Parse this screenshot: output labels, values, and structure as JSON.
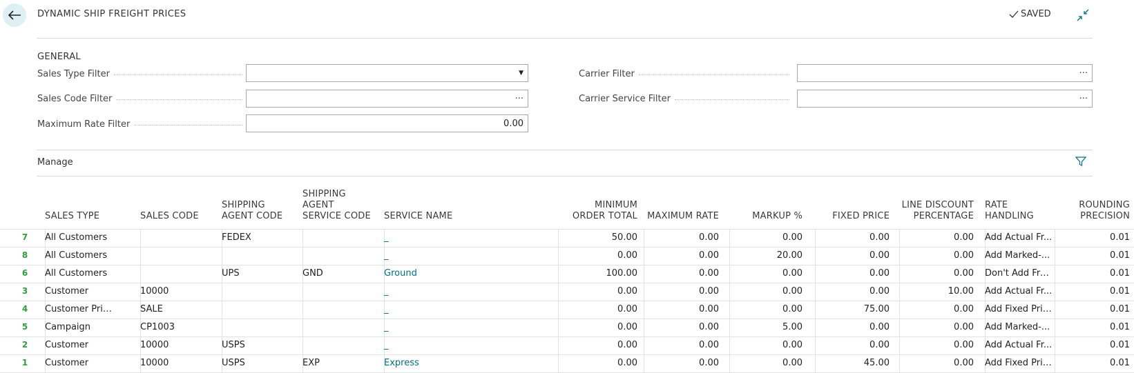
{
  "header": {
    "title": "DYNAMIC SHIP FREIGHT PRICES",
    "saved_label": "SAVED"
  },
  "general": {
    "section_title": "GENERAL",
    "fields": {
      "sales_type_filter": {
        "label": "Sales Type Filter",
        "value": ""
      },
      "sales_code_filter": {
        "label": "Sales Code Filter",
        "value": ""
      },
      "maximum_rate_filter": {
        "label": "Maximum Rate Filter",
        "value": "0.00"
      },
      "carrier_filter": {
        "label": "Carrier Filter",
        "value": ""
      },
      "carrier_service_filter": {
        "label": "Carrier Service Filter",
        "value": ""
      }
    },
    "lookup_symbol": "···",
    "dropdown_symbol": "▼"
  },
  "action_bar": {
    "manage_label": "Manage"
  },
  "table": {
    "columns": [
      [
        "SALES TYPE"
      ],
      [
        "SALES CODE"
      ],
      [
        "SHIPPING",
        "AGENT CODE"
      ],
      [
        "SHIPPING",
        "AGENT",
        "SERVICE CODE"
      ],
      [
        "SERVICE NAME"
      ],
      [
        "MINIMUM",
        "ORDER TOTAL"
      ],
      [
        "MAXIMUM RATE"
      ],
      [
        "MARKUP %"
      ],
      [
        "FIXED PRICE"
      ],
      [
        "LINE DISCOUNT",
        "PERCENTAGE"
      ],
      [
        "RATE",
        "HANDLING"
      ],
      [
        "ROUNDING",
        "PRECISION"
      ]
    ],
    "rows": [
      {
        "num": "7",
        "cells": [
          "All Customers",
          "",
          "FEDEX",
          "",
          "_",
          "50.00",
          "0.00",
          "0.00",
          "0.00",
          "0.00",
          "Add Actual Fr...",
          "0.01"
        ]
      },
      {
        "num": "8",
        "cells": [
          "All Customers",
          "",
          "",
          "",
          "_",
          "0.00",
          "0.00",
          "20.00",
          "0.00",
          "0.00",
          "Add Marked-...",
          "0.01"
        ]
      },
      {
        "num": "6",
        "cells": [
          "All Customers",
          "",
          "UPS",
          "GND",
          "Ground",
          "100.00",
          "0.00",
          "0.00",
          "0.00",
          "0.00",
          "Don't Add Fre...",
          "0.01"
        ]
      },
      {
        "num": "3",
        "cells": [
          "Customer",
          "10000",
          "",
          "",
          "_",
          "0.00",
          "0.00",
          "0.00",
          "0.00",
          "10.00",
          "Add Actual Fr...",
          "0.01"
        ]
      },
      {
        "num": "4",
        "cells": [
          "Customer Pric...",
          "SALE",
          "",
          "",
          "_",
          "0.00",
          "0.00",
          "0.00",
          "75.00",
          "0.00",
          "Add Fixed Pric...",
          "0.01"
        ]
      },
      {
        "num": "5",
        "cells": [
          "Campaign",
          "CP1003",
          "",
          "",
          "_",
          "0.00",
          "0.00",
          "5.00",
          "0.00",
          "0.00",
          "Add Marked-...",
          "0.01"
        ]
      },
      {
        "num": "2",
        "cells": [
          "Customer",
          "10000",
          "USPS",
          "",
          "_",
          "0.00",
          "0.00",
          "0.00",
          "0.00",
          "0.00",
          "Add Actual Fr...",
          "0.01"
        ]
      },
      {
        "num": "1",
        "cells": [
          "Customer",
          "10000",
          "USPS",
          "EXP",
          "Express",
          "0.00",
          "0.00",
          "0.00",
          "45.00",
          "0.00",
          "Add Fixed Pric...",
          "0.01"
        ]
      }
    ]
  },
  "icons": [
    "back-arrow-icon",
    "checkmark-icon",
    "collapse-icon",
    "dropdown-arrow-icon",
    "lookup-ellipsis-icon",
    "filter-funnel-icon"
  ],
  "colors": {
    "accent": "#00707f",
    "row_number": "#2e9e3f",
    "back_button_bg": "#dff0f4"
  }
}
